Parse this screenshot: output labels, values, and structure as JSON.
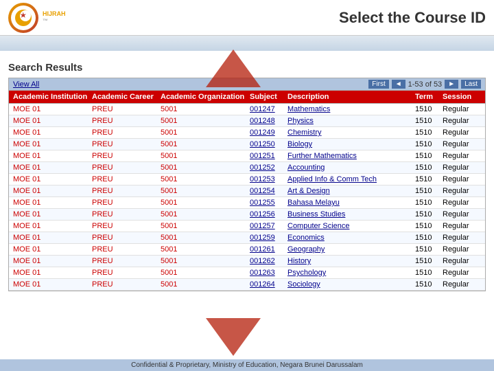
{
  "header": {
    "title": "Select the Course ID",
    "logo_text": "HIJRAH",
    "logo_tm": "™"
  },
  "page": {
    "search_results_label": "Search Results",
    "view_all_label": "View All",
    "pagination": {
      "first_label": "First",
      "last_label": "Last",
      "prev_label": "◄",
      "next_label": "►",
      "info": "1-53 of 53"
    }
  },
  "table": {
    "columns": [
      "Academic Institution",
      "Academic Career",
      "Academic Organization",
      "Subject",
      "Description",
      "Term",
      "Session"
    ],
    "rows": [
      {
        "inst": "MOE 01",
        "career": "PREU",
        "org": "5001",
        "subject": "001247",
        "description": "Mathematics",
        "term": "1510",
        "session": "Regular"
      },
      {
        "inst": "MOE 01",
        "career": "PREU",
        "org": "5001",
        "subject": "001248",
        "description": "Physics",
        "term": "1510",
        "session": "Regular"
      },
      {
        "inst": "MOE 01",
        "career": "PREU",
        "org": "5001",
        "subject": "001249",
        "description": "Chemistry",
        "term": "1510",
        "session": "Regular"
      },
      {
        "inst": "MOE 01",
        "career": "PREU",
        "org": "5001",
        "subject": "001250",
        "description": "Biology",
        "term": "1510",
        "session": "Regular"
      },
      {
        "inst": "MOE 01",
        "career": "PREU",
        "org": "5001",
        "subject": "001251",
        "description": "Further Mathematics",
        "term": "1510",
        "session": "Regular"
      },
      {
        "inst": "MOE 01",
        "career": "PREU",
        "org": "5001",
        "subject": "001252",
        "description": "Accounting",
        "term": "1510",
        "session": "Regular"
      },
      {
        "inst": "MOE 01",
        "career": "PREU",
        "org": "5001",
        "subject": "001253",
        "description": "Applied Info & Comm Tech",
        "term": "1510",
        "session": "Regular"
      },
      {
        "inst": "MOE 01",
        "career": "PREU",
        "org": "5001",
        "subject": "001254",
        "description": "Art & Design",
        "term": "1510",
        "session": "Regular"
      },
      {
        "inst": "MOE 01",
        "career": "PREU",
        "org": "5001",
        "subject": "001255",
        "description": "Bahasa Melayu",
        "term": "1510",
        "session": "Regular"
      },
      {
        "inst": "MOE 01",
        "career": "PREU",
        "org": "5001",
        "subject": "001256",
        "description": "Business Studies",
        "term": "1510",
        "session": "Regular"
      },
      {
        "inst": "MOE 01",
        "career": "PREU",
        "org": "5001",
        "subject": "001257",
        "description": "Computer Science",
        "term": "1510",
        "session": "Regular"
      },
      {
        "inst": "MOE 01",
        "career": "PREU",
        "org": "5001",
        "subject": "001259",
        "description": "Economics",
        "term": "1510",
        "session": "Regular"
      },
      {
        "inst": "MOE 01",
        "career": "PREU",
        "org": "5001",
        "subject": "001261",
        "description": "Geography",
        "term": "1510",
        "session": "Regular"
      },
      {
        "inst": "MOE 01",
        "career": "PREU",
        "org": "5001",
        "subject": "001262",
        "description": "History",
        "term": "1510",
        "session": "Regular"
      },
      {
        "inst": "MOE 01",
        "career": "PREU",
        "org": "5001",
        "subject": "001263",
        "description": "Psychology",
        "term": "1510",
        "session": "Regular"
      },
      {
        "inst": "MOE 01",
        "career": "PREU",
        "org": "5001",
        "subject": "001264",
        "description": "Sociology",
        "term": "1510",
        "session": "Regular"
      }
    ]
  },
  "footer": {
    "text": "Confidential & Proprietary, Ministry of Education, Negara Brunei Darussalam"
  }
}
